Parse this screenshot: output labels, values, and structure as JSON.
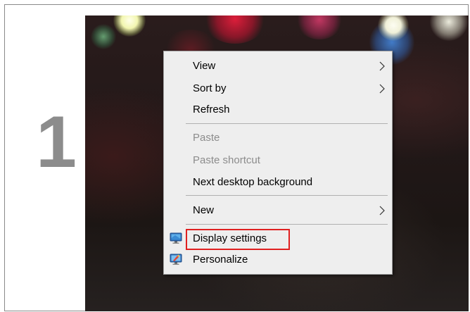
{
  "step": {
    "number": "1"
  },
  "context_menu": {
    "items": [
      {
        "label": "View",
        "enabled": true,
        "submenu": true
      },
      {
        "label": "Sort by",
        "enabled": true,
        "submenu": true
      },
      {
        "label": "Refresh",
        "enabled": true,
        "submenu": false
      },
      {
        "label": "Paste",
        "enabled": false,
        "submenu": false
      },
      {
        "label": "Paste shortcut",
        "enabled": false,
        "submenu": false
      },
      {
        "label": "Next desktop background",
        "enabled": true,
        "submenu": false
      },
      {
        "label": "New",
        "enabled": true,
        "submenu": true
      },
      {
        "label": "Display settings",
        "enabled": true,
        "submenu": false,
        "icon": "display-icon",
        "highlighted": true
      },
      {
        "label": "Personalize",
        "enabled": true,
        "submenu": false,
        "icon": "personalize-icon"
      }
    ]
  },
  "colors": {
    "menu_background": "#eeeeee",
    "disabled_text": "#8c8c8c",
    "highlight_border": "#e02020",
    "step_number": "#8c8c8c"
  }
}
